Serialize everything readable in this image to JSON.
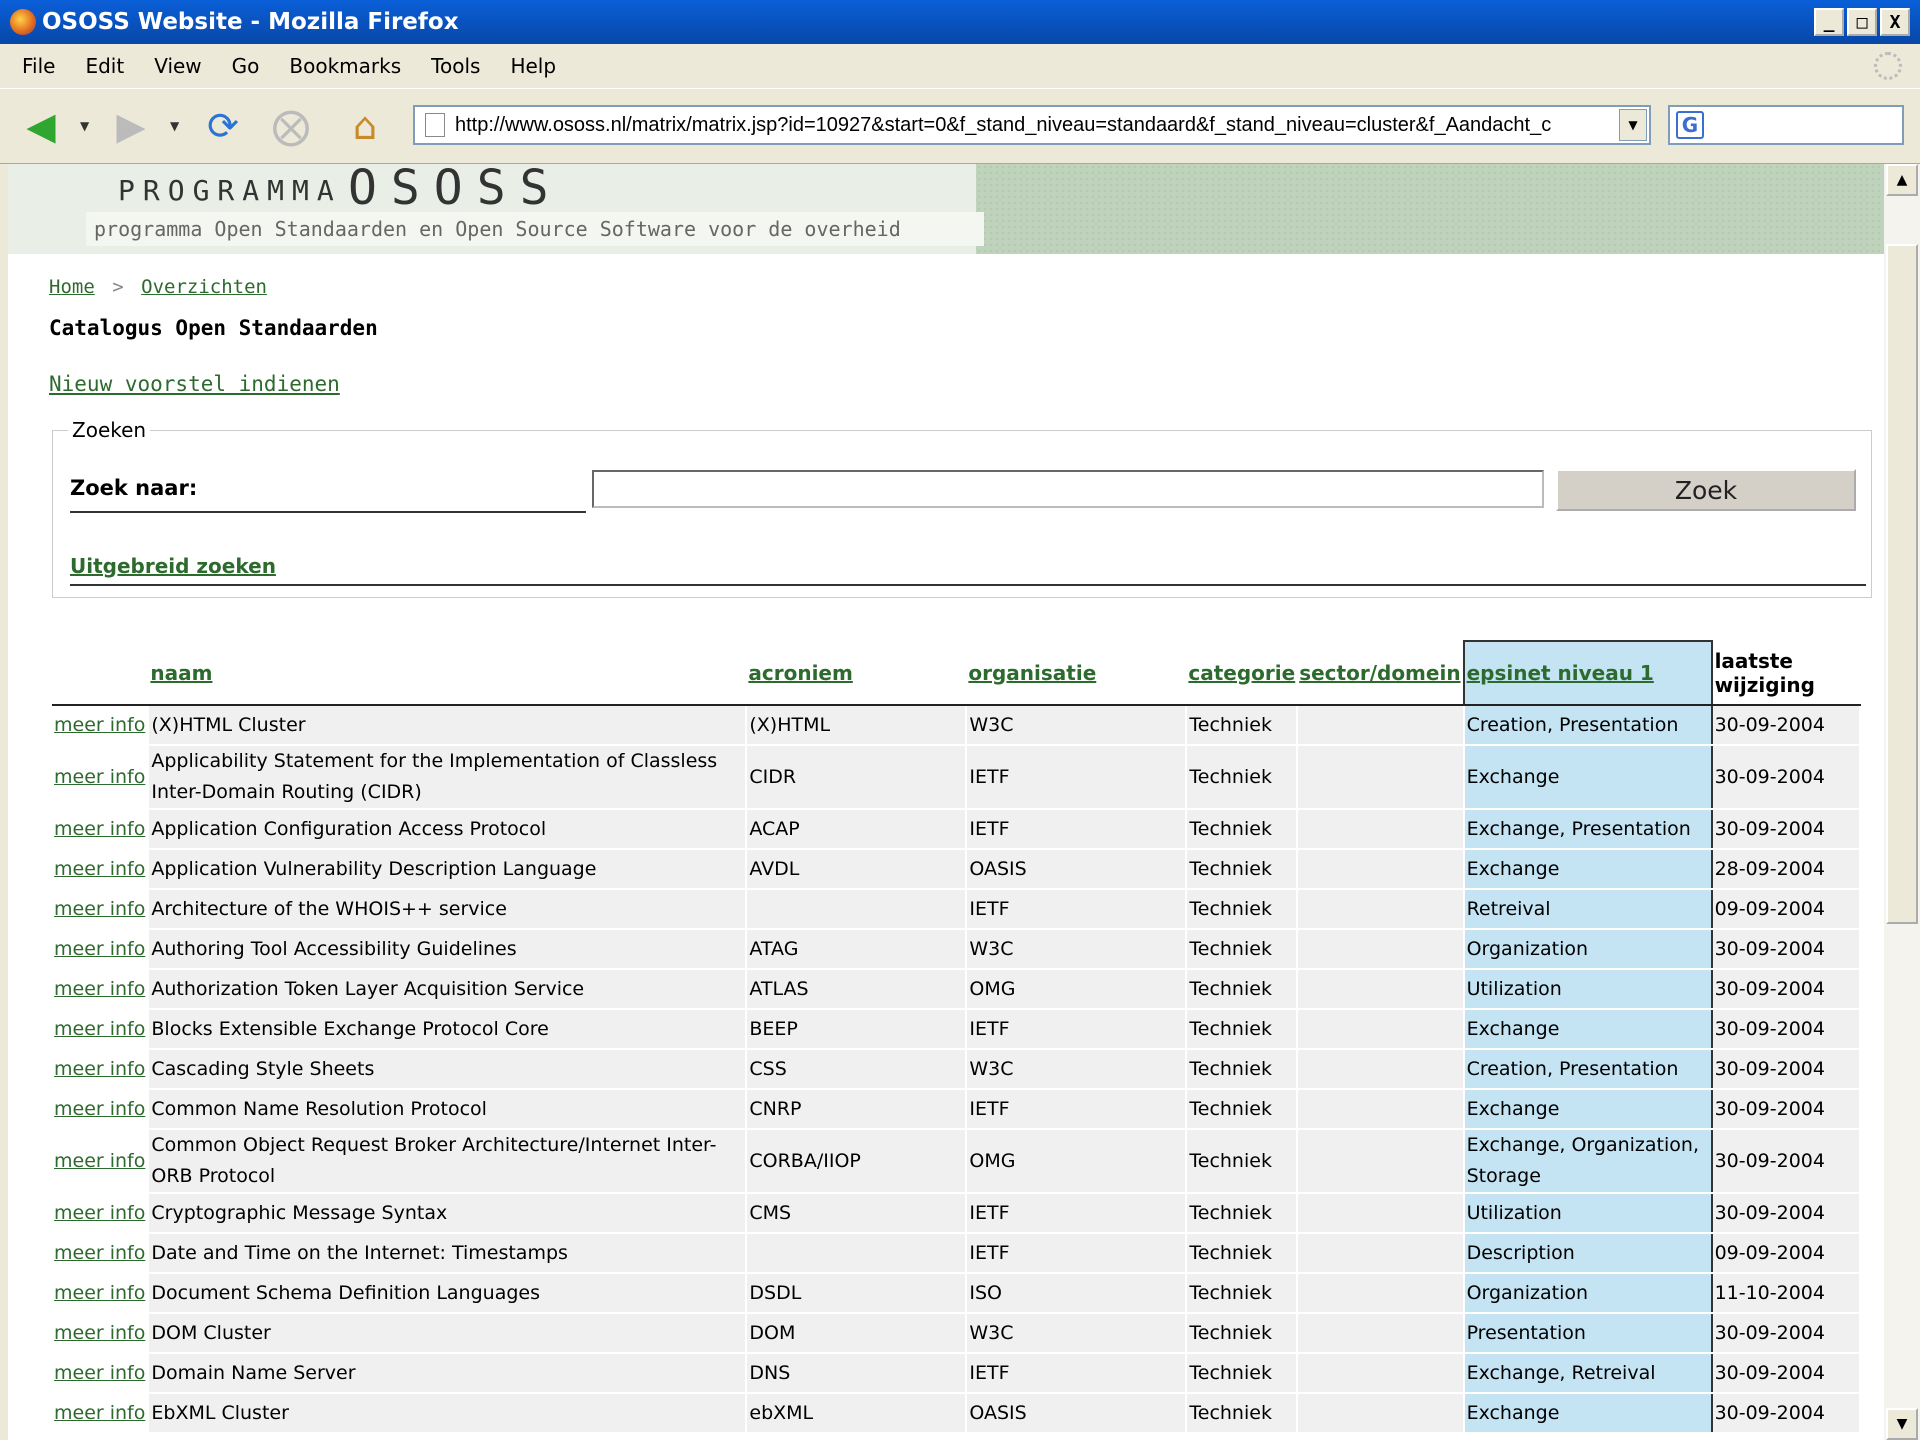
{
  "window": {
    "title": "OSOSS Website - Mozilla Firefox",
    "buttons": [
      "_",
      "□",
      "X"
    ]
  },
  "menu": [
    "File",
    "Edit",
    "View",
    "Go",
    "Bookmarks",
    "Tools",
    "Help"
  ],
  "toolbar": {
    "url": "http://www.ososs.nl/matrix/matrix.jsp?id=10927&start=0&f_stand_niveau=standaard&f_stand_niveau=cluster&f_Aandacht_c",
    "search_engine_letter": "G"
  },
  "banner": {
    "programma": "PROGRAMMA",
    "ososs": "OSOSS",
    "subtitle": "programma Open Standaarden en Open Source Software voor de overheid"
  },
  "breadcrumb": {
    "home": "Home",
    "separator": ">",
    "overzichten": "Overzichten"
  },
  "page_title": "Catalogus Open Standaarden",
  "nieuw_link": "Nieuw voorstel indienen",
  "search": {
    "legend": "Zoeken",
    "label": "Zoek naar:",
    "value": "",
    "button": "Zoek",
    "advanced": "Uitgebreid zoeken"
  },
  "table": {
    "headers": [
      "naam",
      "acroniem",
      "organisatie",
      "categorie",
      "sector/domein",
      "epsinet niveau 1",
      "laatste wijziging"
    ],
    "row_link": "meer info",
    "rows": [
      {
        "naam": "(X)HTML Cluster",
        "acroniem": "(X)HTML",
        "organisatie": "W3C",
        "categorie": "Techniek",
        "sector": "",
        "epsinet": "Creation, Presentation",
        "datum": "30-09-2004"
      },
      {
        "naam": "Applicability Statement for the Implementation of Classless Inter-Domain Routing (CIDR)",
        "acroniem": "CIDR",
        "organisatie": "IETF",
        "categorie": "Techniek",
        "sector": "",
        "epsinet": "Exchange",
        "datum": "30-09-2004"
      },
      {
        "naam": "Application Configuration Access Protocol",
        "acroniem": "ACAP",
        "organisatie": "IETF",
        "categorie": "Techniek",
        "sector": "",
        "epsinet": "Exchange, Presentation",
        "datum": "30-09-2004"
      },
      {
        "naam": "Application Vulnerability Description Language",
        "acroniem": "AVDL",
        "organisatie": "OASIS",
        "categorie": "Techniek",
        "sector": "",
        "epsinet": "Exchange",
        "datum": "28-09-2004"
      },
      {
        "naam": "Architecture of the WHOIS++ service",
        "acroniem": "",
        "organisatie": "IETF",
        "categorie": "Techniek",
        "sector": "",
        "epsinet": "Retreival",
        "datum": "09-09-2004"
      },
      {
        "naam": "Authoring Tool Accessibility Guidelines",
        "acroniem": "ATAG",
        "organisatie": "W3C",
        "categorie": "Techniek",
        "sector": "",
        "epsinet": "Organization",
        "datum": "30-09-2004"
      },
      {
        "naam": "Authorization Token Layer Acquisition Service",
        "acroniem": "ATLAS",
        "organisatie": "OMG",
        "categorie": "Techniek",
        "sector": "",
        "epsinet": "Utilization",
        "datum": "30-09-2004"
      },
      {
        "naam": "Blocks Extensible Exchange Protocol Core",
        "acroniem": "BEEP",
        "organisatie": "IETF",
        "categorie": "Techniek",
        "sector": "",
        "epsinet": "Exchange",
        "datum": "30-09-2004"
      },
      {
        "naam": "Cascading Style Sheets",
        "acroniem": "CSS",
        "organisatie": "W3C",
        "categorie": "Techniek",
        "sector": "",
        "epsinet": "Creation, Presentation",
        "datum": "30-09-2004"
      },
      {
        "naam": "Common Name Resolution Protocol",
        "acroniem": "CNRP",
        "organisatie": "IETF",
        "categorie": "Techniek",
        "sector": "",
        "epsinet": "Exchange",
        "datum": "30-09-2004"
      },
      {
        "naam": "Common Object Request Broker Architecture/Internet Inter-ORB Protocol",
        "acroniem": "CORBA/IIOP",
        "organisatie": "OMG",
        "categorie": "Techniek",
        "sector": "",
        "epsinet": "Exchange, Organization, Storage",
        "datum": "30-09-2004"
      },
      {
        "naam": "Cryptographic Message Syntax",
        "acroniem": "CMS",
        "organisatie": "IETF",
        "categorie": "Techniek",
        "sector": "",
        "epsinet": "Utilization",
        "datum": "30-09-2004"
      },
      {
        "naam": "Date and Time on the Internet: Timestamps",
        "acroniem": "",
        "organisatie": "IETF",
        "categorie": "Techniek",
        "sector": "",
        "epsinet": "Description",
        "datum": "09-09-2004"
      },
      {
        "naam": "Document Schema Definition Languages",
        "acroniem": "DSDL",
        "organisatie": "ISO",
        "categorie": "Techniek",
        "sector": "",
        "epsinet": "Organization",
        "datum": "11-10-2004"
      },
      {
        "naam": "DOM Cluster",
        "acroniem": "DOM",
        "organisatie": "W3C",
        "categorie": "Techniek",
        "sector": "",
        "epsinet": "Presentation",
        "datum": "30-09-2004"
      },
      {
        "naam": "Domain Name Server",
        "acroniem": "DNS",
        "organisatie": "IETF",
        "categorie": "Techniek",
        "sector": "",
        "epsinet": "Exchange, Retreival",
        "datum": "30-09-2004"
      },
      {
        "naam": "EbXML Cluster",
        "acroniem": "ebXML",
        "organisatie": "OASIS",
        "categorie": "Techniek",
        "sector": "",
        "epsinet": "Exchange",
        "datum": "30-09-2004"
      }
    ]
  }
}
